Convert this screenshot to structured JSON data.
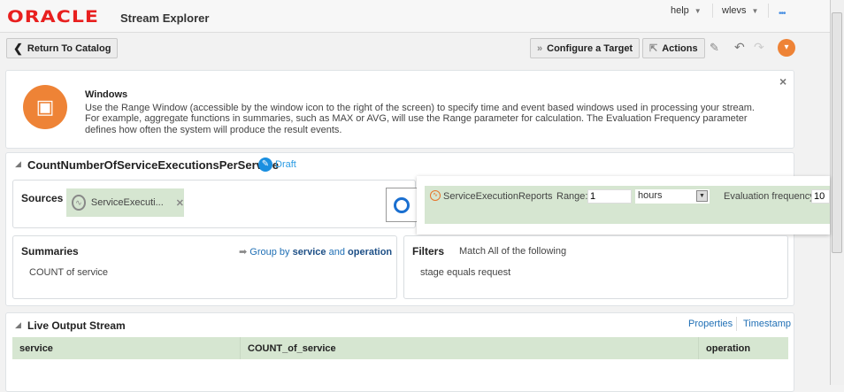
{
  "header": {
    "logo": "ORACLE",
    "app_title": "Stream Explorer",
    "help": "help",
    "user": "wlevs",
    "more": "•••"
  },
  "toolbar": {
    "return": "Return To Catalog",
    "configure": "Configure a Target",
    "actions": "Actions"
  },
  "info": {
    "title": "Windows",
    "text": "Use the Range Window (accessible by the window icon to the right of the screen) to specify time and event based windows used in processing your stream. For example, aggregate functions in summaries, such as MAX or AVG, will use the Range parameter for calculation. The Evaluation Frequency parameter defines how often the system will produce the result events.",
    "close": "×"
  },
  "query": {
    "title": "CountNumberOfServiceExecutionsPerService",
    "status": "Draft",
    "sources": {
      "label": "Sources",
      "chip": "ServiceExecuti..."
    },
    "window": {
      "source": "ServiceExecutionReports",
      "range_label": "Range:",
      "range_value": "1",
      "unit": "hours",
      "freq_label": "Evaluation frequency:",
      "freq_value": "10"
    },
    "summaries": {
      "label": "Summaries",
      "group_prefix": "Group by",
      "group_field1": "service",
      "group_and": "and",
      "group_field2": "operation",
      "item": "COUNT of service"
    },
    "filters": {
      "label": "Filters",
      "match": "Match All of the following",
      "item": "stage equals request"
    }
  },
  "output": {
    "title": "Live Output Stream",
    "properties": "Properties",
    "timestamp": "Timestamp",
    "columns": [
      "service",
      "COUNT_of_service",
      "operation"
    ]
  }
}
